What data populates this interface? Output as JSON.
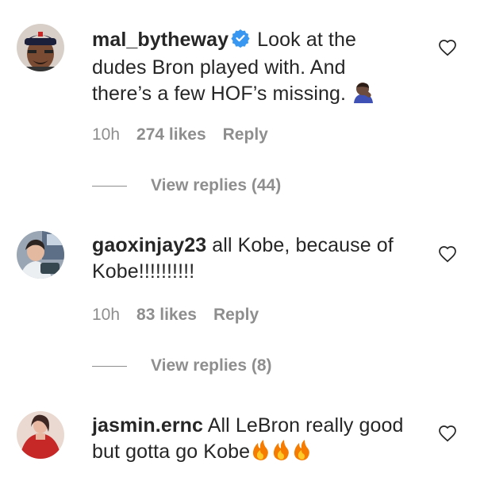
{
  "comments": [
    {
      "username": "mal_bytheway",
      "verified": true,
      "text_line1": "Look at the",
      "text_line2": "dudes Bron played with. And",
      "text_line3": "there’s a few HOF’s missing.",
      "emoji": "man-facepalming-icon",
      "time": "10h",
      "likes": "274 likes",
      "reply": "Reply",
      "view_replies": "View replies (44)"
    },
    {
      "username": "gaoxinjay23",
      "verified": false,
      "text_line1": "all Kobe, because of",
      "text_line2": "Kobe!!!!!!!!!!",
      "time": "10h",
      "likes": "83 likes",
      "reply": "Reply",
      "view_replies": "View replies (8)"
    },
    {
      "username": "jasmin.ernc",
      "verified": false,
      "text_line1": "All LeBron really good",
      "text_line2": "but gotta go Kobe",
      "emoji": "fire-icon x3"
    }
  ],
  "colors": {
    "text": "#262626",
    "secondary": "#8e8e8e",
    "verified_badge": "#3897f0",
    "fire": "#f57c00"
  }
}
